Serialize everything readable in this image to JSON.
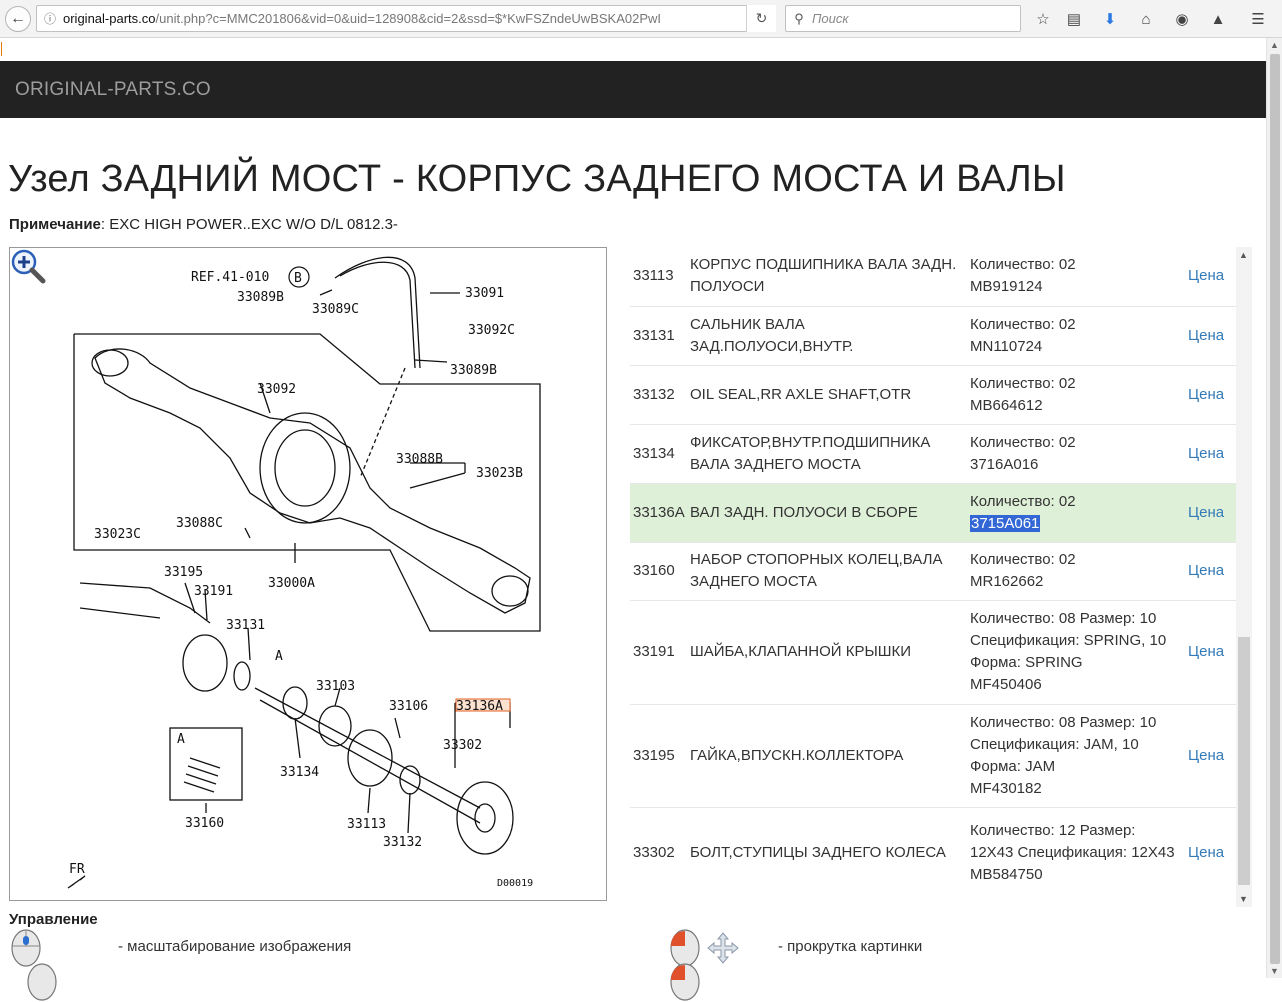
{
  "browser": {
    "url_domain": "original-parts.co",
    "url_path": "/unit.php?c=MMC201806&vid=0&uid=128908&cid=2&ssd=$*KwFSZndeUwBSKA02PwI",
    "search_placeholder": "Поиск"
  },
  "header": {
    "brand": "ORIGINAL-PARTS.CO"
  },
  "page": {
    "title": "Узел ЗАДНИЙ МОСТ - КОРПУС ЗАДНЕГО МОСТА И ВАЛЫ",
    "note_label": "Примечание",
    "note_text": ": EXC HIGH POWER..EXC W/O D/L 0812.3-"
  },
  "diagram": {
    "code": "D00019",
    "labels": [
      "REF.41-010",
      "B",
      "33089B",
      "33089C",
      "33091",
      "33092C",
      "33089B",
      "33092",
      "33088B",
      "33023B",
      "33088C",
      "33023C",
      "33000A",
      "33195",
      "33191",
      "33131",
      "A",
      "33103",
      "33106",
      "33136A",
      "33302",
      "33134",
      "33113",
      "33132",
      "A",
      "33160",
      "FR"
    ]
  },
  "parts": [
    {
      "code": "33113",
      "name": "КОРПУС ПОДШИПНИКА ВАЛА ЗАДН. ПОЛУОСИ",
      "qty_lines": [
        "Количество: 02",
        "MB919124"
      ],
      "price": "Цена"
    },
    {
      "code": "33131",
      "name": "САЛЬНИК ВАЛА ЗАД.ПОЛУОСИ,ВНУТР.",
      "qty_lines": [
        "Количество: 02",
        "MN110724"
      ],
      "price": "Цена"
    },
    {
      "code": "33132",
      "name": "OIL SEAL,RR AXLE SHAFT,OTR",
      "qty_lines": [
        "Количество: 02",
        "MB664612"
      ],
      "price": "Цена"
    },
    {
      "code": "33134",
      "name": "ФИКСАТОР,ВНУТР.ПОДШИПНИКА ВАЛА ЗАДНЕГО МОСТА",
      "qty_lines": [
        "Количество: 02",
        "3716A016"
      ],
      "price": "Цена"
    },
    {
      "code": "33136A",
      "name": "ВАЛ ЗАДН. ПОЛУОСИ В СБОРЕ",
      "qty_lines": [
        "Количество: 02",
        "3715A061"
      ],
      "price": "Цена",
      "selected": true
    },
    {
      "code": "33160",
      "name": "НАБОР СТОПОРНЫХ КОЛЕЦ,ВАЛА ЗАДНЕГО МОСТА",
      "qty_lines": [
        "Количество: 02",
        "MR162662"
      ],
      "price": "Цена"
    },
    {
      "code": "33191",
      "name": "ШАЙБА,КЛАПАННОЙ КРЫШКИ",
      "qty_lines": [
        "Количество: 08 Размер: 10",
        "Спецификация: SPRING, 10",
        "Форма: SPRING",
        "MF450406"
      ],
      "price": "Цена"
    },
    {
      "code": "33195",
      "name": "ГАЙКА,ВПУСКН.КОЛЛЕКТОРА",
      "qty_lines": [
        "Количество: 08 Размер: 10",
        "Спецификация: JAM, 10",
        "Форма: JAM",
        "MF430182"
      ],
      "price": "Цена"
    },
    {
      "code": "33302",
      "name": "БОЛТ,СТУПИЦЫ ЗАДНЕГО КОЛЕСА",
      "qty_lines": [
        "Количество: 12 Размер:",
        "12X43 Спецификация: 12X43",
        "MB584750"
      ],
      "price": "Цена"
    }
  ],
  "controls": {
    "title": "Управление",
    "zoom_text": "- масштабирование изображения",
    "scroll_text": "- прокрутка картинки"
  }
}
